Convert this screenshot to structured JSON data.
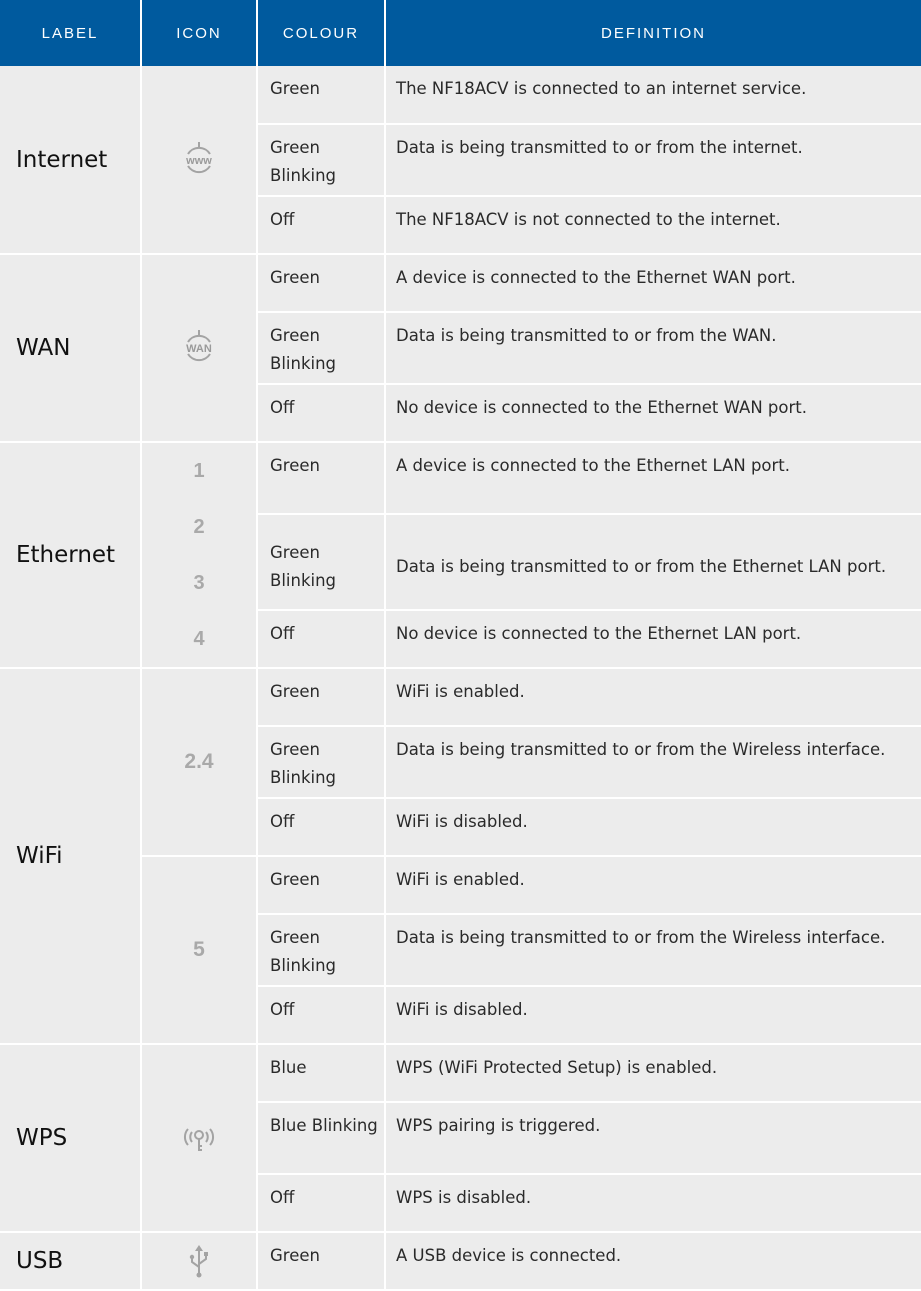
{
  "headers": {
    "label": "LABEL",
    "icon": "ICON",
    "colour": "COLOUR",
    "definition": "DEFINITION"
  },
  "header_color": "#005a9e",
  "cell_color": "#ececec",
  "groups": {
    "internet": {
      "label": "Internet",
      "icon": "www-globe-icon",
      "icon_text": "www",
      "rows": [
        {
          "colour": "Green",
          "definition": "The NF18ACV is connected to an internet service."
        },
        {
          "colour": "Green Blinking",
          "definition": "Data is being transmitted to or from the internet."
        },
        {
          "colour": "Off",
          "definition": "The NF18ACV is not connected to the internet."
        }
      ]
    },
    "wan": {
      "label": "WAN",
      "icon": "wan-globe-icon",
      "icon_text": "WAN",
      "rows": [
        {
          "colour": "Green",
          "definition": "A device is connected to the Ethernet WAN port."
        },
        {
          "colour": "Green Blinking",
          "definition": "Data is being transmitted to or from the WAN."
        },
        {
          "colour": "Off",
          "definition": "No device is connected to the Ethernet WAN port."
        }
      ]
    },
    "ethernet": {
      "label": "Ethernet",
      "ports": [
        "1",
        "2",
        "3",
        "4"
      ],
      "rows": [
        {
          "colour": "Green",
          "definition": "A device is connected to the Ethernet LAN port."
        },
        {
          "colour": "Green Blinking",
          "definition": "Data is being transmitted to or from the Ethernet LAN port."
        },
        {
          "colour": "Off",
          "definition": "No device is connected to the Ethernet LAN port."
        }
      ]
    },
    "wifi": {
      "label": "WiFi",
      "bands": [
        {
          "icon_text": "2.4",
          "rows": [
            {
              "colour": "Green",
              "definition": "WiFi is enabled."
            },
            {
              "colour": "Green Blinking",
              "definition": "Data is being transmitted to or from the Wireless interface."
            },
            {
              "colour": "Off",
              "definition": "WiFi is disabled."
            }
          ]
        },
        {
          "icon_text": "5",
          "rows": [
            {
              "colour": "Green",
              "definition": "WiFi is enabled."
            },
            {
              "colour": "Green Blinking",
              "definition": "Data is being transmitted to or from the Wireless interface."
            },
            {
              "colour": "Off",
              "definition": "WiFi is disabled."
            }
          ]
        }
      ]
    },
    "wps": {
      "label": "WPS",
      "icon": "wps-key-icon",
      "rows": [
        {
          "colour": "Blue",
          "definition": "WPS (WiFi Protected Setup) is enabled."
        },
        {
          "colour": "Blue Blinking",
          "definition": "WPS pairing is triggered."
        },
        {
          "colour": "Off",
          "definition": "WPS is disabled."
        }
      ]
    },
    "usb": {
      "label": "USB",
      "icon": "usb-icon",
      "rows": [
        {
          "colour": "Green",
          "definition": "A USB device is connected."
        }
      ]
    }
  }
}
